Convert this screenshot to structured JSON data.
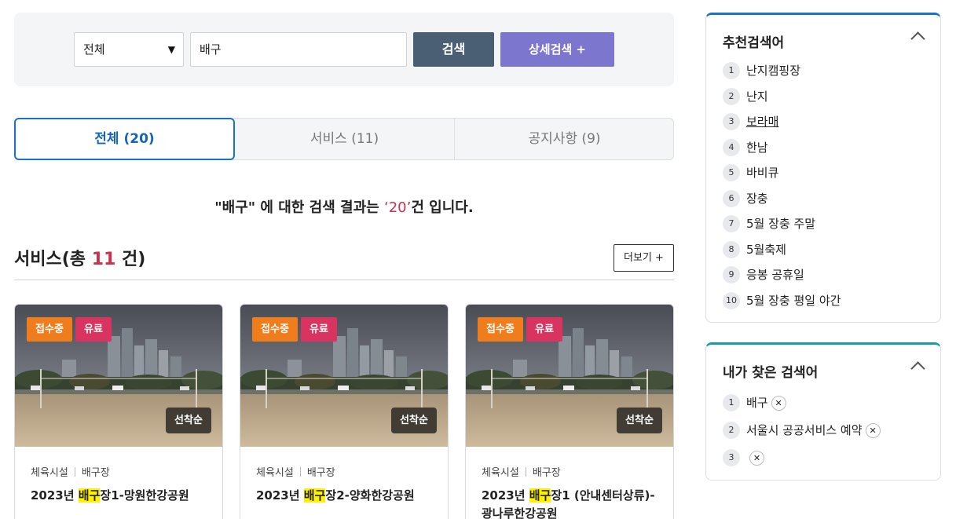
{
  "search": {
    "category": "전체",
    "query": "배구",
    "search_label": "검색",
    "advanced_label": "상세검색 +"
  },
  "tabs": [
    {
      "label": "전체 (20)",
      "active": true
    },
    {
      "label": "서비스 (11)",
      "active": false
    },
    {
      "label": "공지사항 (9)",
      "active": false
    }
  ],
  "result": {
    "prefix": "\"배구\" 에 대한 검색 결과는 ",
    "count": "‘20’",
    "suffix": "건 입니다."
  },
  "services": {
    "title_prefix": "서비스(총 ",
    "count": "11",
    "title_suffix": " 건)",
    "more_label": "더보기 +"
  },
  "cards": [
    {
      "status": "접수중",
      "fee": "유료",
      "order": "선착순",
      "category": "체육시설",
      "subcategory": "배구장",
      "title_pre": "2023년 ",
      "title_hl": "배구",
      "title_post": "장1-망원한강공원"
    },
    {
      "status": "접수중",
      "fee": "유료",
      "order": "선착순",
      "category": "체육시설",
      "subcategory": "배구장",
      "title_pre": "2023년 ",
      "title_hl": "배구",
      "title_post": "장2-양화한강공원"
    },
    {
      "status": "접수중",
      "fee": "유료",
      "order": "선착순",
      "category": "체육시설",
      "subcategory": "배구장",
      "title_pre": "2023년 ",
      "title_hl": "배구",
      "title_post": "장1 (안내센터상류)-광나루한강공원"
    }
  ],
  "recommended": {
    "title": "추천검색어",
    "items": [
      {
        "num": "1",
        "text": "난지캠핑장"
      },
      {
        "num": "2",
        "text": "난지"
      },
      {
        "num": "3",
        "text": "보라매"
      },
      {
        "num": "4",
        "text": "한남"
      },
      {
        "num": "5",
        "text": "바비큐"
      },
      {
        "num": "6",
        "text": "장충"
      },
      {
        "num": "7",
        "text": "5월 장충 주말"
      },
      {
        "num": "8",
        "text": "5월축제"
      },
      {
        "num": "9",
        "text": "응봉 공휴일"
      },
      {
        "num": "10",
        "text": "5월 장충 평일 야간"
      }
    ]
  },
  "recent": {
    "title": "내가 찾은 검색어",
    "items": [
      {
        "num": "1",
        "text": "배구"
      },
      {
        "num": "2",
        "text": "서울시 공공서비스 예약"
      },
      {
        "num": "3",
        "text": ""
      }
    ]
  },
  "icons": {
    "dropdown": "caret-down-icon",
    "collapse": "chevron-up-icon",
    "remove": "close-icon"
  },
  "colors": {
    "primary": "#1a73c9",
    "search_button": "#4a5f73",
    "advanced_button": "#7c76cf",
    "accent": "#c8324d",
    "status_badge": "#f07d1c",
    "fee_badge": "#d8345f",
    "highlight": "#fff200"
  }
}
